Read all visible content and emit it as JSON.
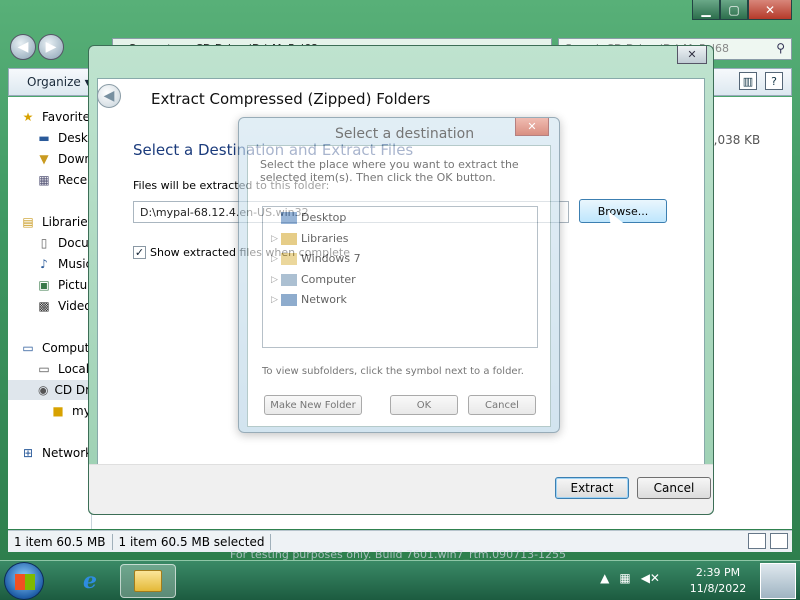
{
  "explorer": {
    "address": "▸ Computer ▸ CD Drive (D:) MyPal68",
    "search_placeholder": "Search CD Drive (D:) MyPal68",
    "toolbar": {
      "organize": "Organize ▾"
    },
    "nav": {
      "favorites": "Favorites",
      "desktop": "Desktop",
      "downloads": "Downloads",
      "recent": "Recent Places",
      "libraries": "Libraries",
      "documents": "Documents",
      "music": "Music",
      "pictures": "Pictures",
      "videos": "Videos",
      "computer": "Computer",
      "local_disk": "Local Disk (C:)",
      "cd_drive": "CD Drive (D:)",
      "mypal": "mypal",
      "network": "Network"
    },
    "file_size": "2,038 KB",
    "status": {
      "items": "1 item 60.5 MB",
      "selected": "1 item 60.5 MB selected"
    },
    "watermark": "For testing purposes only. Build 7601.win7_rtm.090713-1255"
  },
  "wizard": {
    "title": "Extract Compressed (Zipped) Folders",
    "heading": "Select a Destination and Extract Files",
    "files_label": "Files will be extracted to this folder:",
    "path": "D:\\mypal-68.12.4.en-US.win32",
    "browse_label": "Browse...",
    "show_files": "Show extracted files when complete",
    "extract_label": "Extract",
    "cancel_label": "Cancel"
  },
  "browse_dialog": {
    "title": "Select a destination",
    "description": "Select the place where you want to extract the selected item(s).  Then click the OK button.",
    "tree": [
      "Desktop",
      "Libraries",
      "Windows 7",
      "Computer",
      "Network"
    ],
    "hint": "To view subfolders, click the symbol next to a folder.",
    "make_folder": "Make New Folder",
    "ok": "OK",
    "cancel": "Cancel"
  },
  "taskbar": {
    "time": "2:39 PM",
    "date": "11/8/2022"
  },
  "colors": {
    "accent": "#3c7fb1",
    "heading": "#1b3b7c",
    "frame": "#3f9862"
  }
}
